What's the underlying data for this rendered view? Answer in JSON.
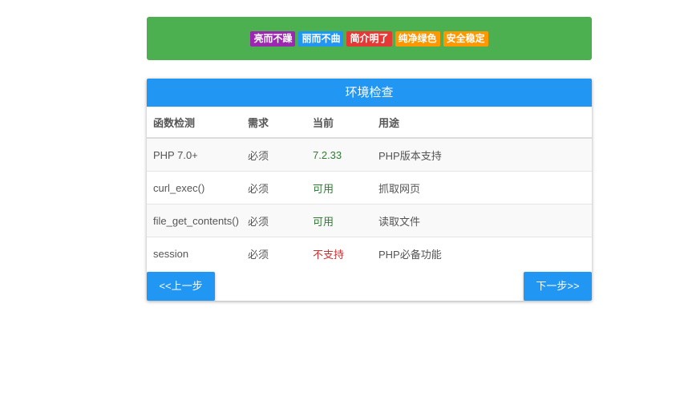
{
  "banner": {
    "tags": [
      {
        "label": "亮而不躁",
        "color": "#9c27b0"
      },
      {
        "label": "丽而不曲",
        "color": "#2196f3"
      },
      {
        "label": "简介明了",
        "color": "#e53935"
      },
      {
        "label": "纯净绿色",
        "color": "#ff9800"
      },
      {
        "label": "安全稳定",
        "color": "#ff9800"
      }
    ]
  },
  "card": {
    "title": "环境检查",
    "headers": [
      "函数检测",
      "需求",
      "当前",
      "用途"
    ],
    "rows": [
      {
        "name": "PHP 7.0+",
        "requirement": "必须",
        "current": "7.2.33",
        "status": "ok",
        "purpose": "PHP版本支持"
      },
      {
        "name": "curl_exec()",
        "requirement": "必须",
        "current": "可用",
        "status": "ok",
        "purpose": "抓取网页"
      },
      {
        "name": "file_get_contents()",
        "requirement": "必须",
        "current": "可用",
        "status": "ok",
        "purpose": "读取文件"
      },
      {
        "name": "session",
        "requirement": "必须",
        "current": "不支持",
        "status": "bad",
        "purpose": "PHP必备功能"
      }
    ],
    "prev_label": "<<上一步",
    "next_label": "下一步>>"
  },
  "colors": {
    "banner_bg": "#4caf50",
    "header_bg": "#2196f3",
    "status_ok": "#2e7d32",
    "status_bad": "#d32f2f"
  }
}
